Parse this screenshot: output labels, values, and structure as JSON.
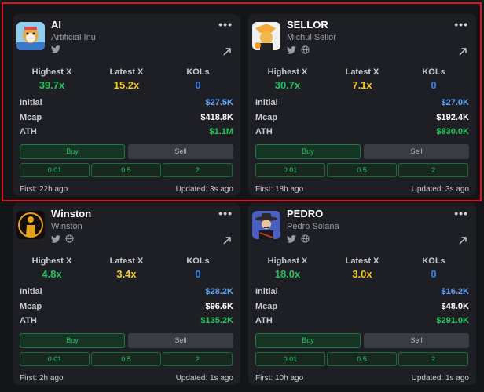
{
  "colors": {
    "accent_green": "#22c55e",
    "accent_yellow": "#facc15",
    "accent_blue": "#3b82f6",
    "highlight_red": "#e3131b"
  },
  "stat_labels": {
    "highest": "Highest X",
    "latest": "Latest X",
    "kols": "KOLs"
  },
  "row_labels": {
    "initial": "Initial",
    "mcap": "Mcap",
    "ath": "ATH"
  },
  "buttons": {
    "buy": "Buy",
    "sell": "Sell",
    "amounts": [
      "0.01",
      "0.5",
      "2"
    ]
  },
  "cards": [
    {
      "symbol": "AI",
      "name": "Artificial Inu",
      "socials": [
        "twitter-icon"
      ],
      "highest": "39.7x",
      "latest": "15.2x",
      "kols": "0",
      "initial": "$27.5K",
      "mcap": "$418.8K",
      "ath": "$1.1M",
      "first": "First: 22h ago",
      "updated": "Updated: 3s ago",
      "selected": true
    },
    {
      "symbol": "SELLOR",
      "name": "Michul Sellor",
      "socials": [
        "twitter-icon",
        "globe-icon"
      ],
      "highest": "30.7x",
      "latest": "7.1x",
      "kols": "0",
      "initial": "$27.0K",
      "mcap": "$192.4K",
      "ath": "$830.0K",
      "first": "First: 18h ago",
      "updated": "Updated: 3s ago"
    },
    {
      "symbol": "Winston",
      "name": "Winston",
      "socials": [
        "twitter-icon",
        "globe-icon"
      ],
      "highest": "4.8x",
      "latest": "3.4x",
      "kols": "0",
      "initial": "$28.2K",
      "mcap": "$96.6K",
      "ath": "$135.2K",
      "first": "First: 2h ago",
      "updated": "Updated: 1s ago"
    },
    {
      "symbol": "PEDRO",
      "name": "Pedro Solana",
      "socials": [
        "twitter-icon",
        "globe-icon"
      ],
      "highest": "18.0x",
      "latest": "3.0x",
      "kols": "0",
      "initial": "$16.2K",
      "mcap": "$48.0K",
      "ath": "$291.0K",
      "first": "First: 10h ago",
      "updated": "Updated: 1s ago"
    }
  ]
}
